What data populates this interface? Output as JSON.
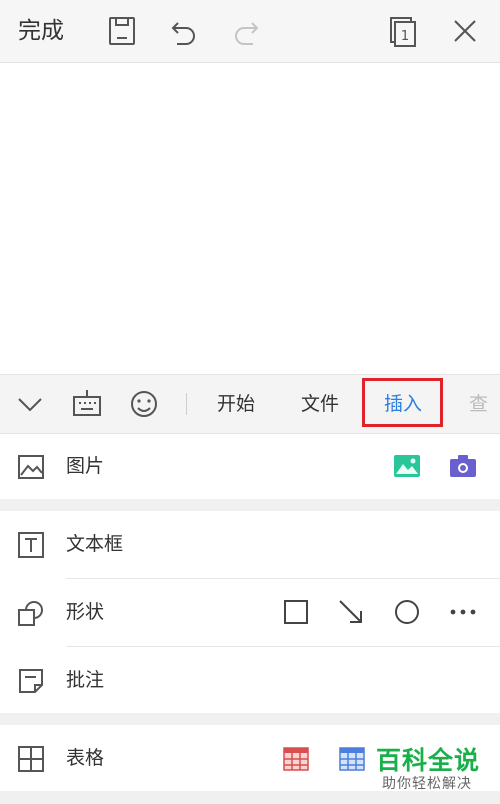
{
  "topbar": {
    "done_label": "完成",
    "icons": [
      "save-icon",
      "undo-icon",
      "redo-icon",
      "page-count-icon",
      "close-icon"
    ],
    "page_count": "1"
  },
  "toolstrip": {
    "icons": [
      "collapse-chevron-icon",
      "keyboard-icon",
      "emoji-icon"
    ],
    "tabs": [
      "开始",
      "文件",
      "插入",
      "查"
    ],
    "active_tab": "插入",
    "active_color": "#2f7fe0",
    "highlight_color": "#e0222a"
  },
  "insert_items": [
    {
      "label": "图片",
      "icon": "image-icon",
      "actions": [
        "gallery-icon",
        "camera-icon"
      ]
    },
    {
      "label": "文本框",
      "icon": "textbox-icon",
      "actions": []
    },
    {
      "label": "形状",
      "icon": "shapes-icon",
      "actions": [
        "rectangle-shape-icon",
        "arrow-shape-icon",
        "circle-shape-icon",
        "more-icon"
      ]
    },
    {
      "label": "批注",
      "icon": "comment-icon",
      "actions": []
    },
    {
      "label": "表格",
      "icon": "table-icon",
      "actions": [
        "red-table-icon",
        "blue-table-icon"
      ]
    }
  ],
  "watermark": {
    "title": "百科全说",
    "subtitle": "助你轻松解决",
    "color": "#19b04a"
  }
}
